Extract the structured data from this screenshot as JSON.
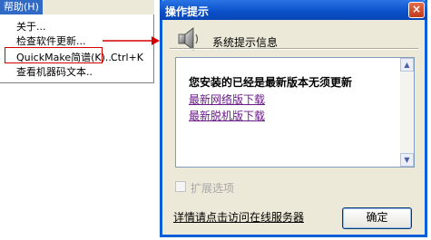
{
  "menu": {
    "title": "帮助(H)",
    "items": [
      {
        "label": "关于...",
        "shortcut": ""
      },
      {
        "label": "检查软件更新...",
        "shortcut": ""
      },
      {
        "label": "QuickMake简谱(K)...",
        "shortcut": "Ctrl+K"
      },
      {
        "label": "查看机器码文本..",
        "shortcut": ""
      }
    ]
  },
  "dialog": {
    "title": "操作提示",
    "close_label": "×",
    "system_label": "系统提示信息",
    "message": "您安装的已经是最新版本无须更新",
    "links": [
      "最新网络版下载",
      "最新脱机版下载"
    ],
    "scroll_up": "▲",
    "scroll_down": "▼",
    "expand_option": "扩展选项",
    "server_link": "详情请点击访问在线服务器",
    "ok_label": "确定"
  },
  "colors": {
    "titlebar": "#0a5fd8",
    "highlight": "#d40000",
    "link": "#6b1a8a"
  }
}
